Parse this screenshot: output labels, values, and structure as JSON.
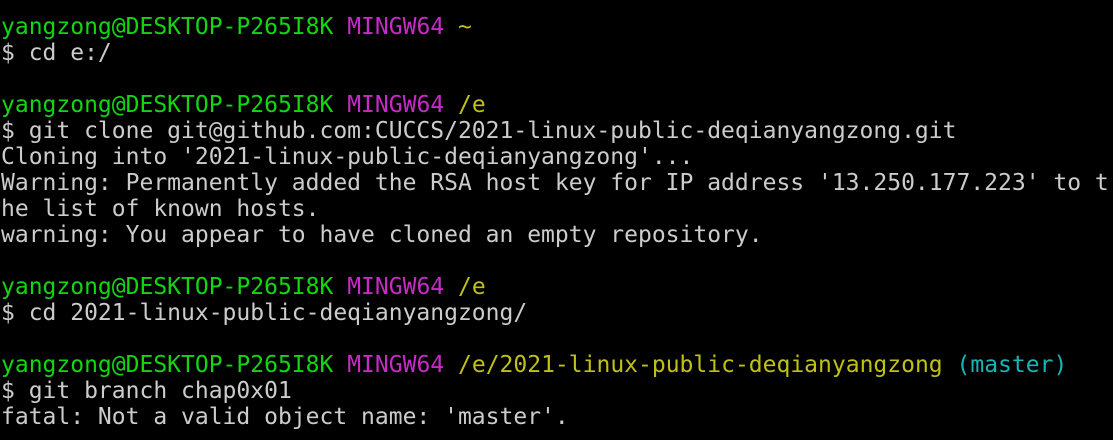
{
  "colors": {
    "background": "#000000",
    "default_text": "#cccccc",
    "user_host": "#13d613",
    "system": "#c62bc6",
    "path": "#c0c01a",
    "branch": "#19b5b5"
  },
  "terminal": {
    "blocks": [
      {
        "prompt": {
          "user_host": "yangzong@DESKTOP-P265I8K",
          "system": "MINGW64",
          "path": "~",
          "branch": ""
        },
        "command": "$ cd e:/",
        "output": []
      },
      {
        "prompt": {
          "user_host": "yangzong@DESKTOP-P265I8K",
          "system": "MINGW64",
          "path": "/e",
          "branch": ""
        },
        "command": "$ git clone git@github.com:CUCCS/2021-linux-public-deqianyangzong.git",
        "output": [
          "Cloning into '2021-linux-public-deqianyangzong'...",
          "Warning: Permanently added the RSA host key for IP address '13.250.177.223' to t",
          "he list of known hosts.",
          "warning: You appear to have cloned an empty repository."
        ]
      },
      {
        "prompt": {
          "user_host": "yangzong@DESKTOP-P265I8K",
          "system": "MINGW64",
          "path": "/e",
          "branch": ""
        },
        "command": "$ cd 2021-linux-public-deqianyangzong/",
        "output": []
      },
      {
        "prompt": {
          "user_host": "yangzong@DESKTOP-P265I8K",
          "system": "MINGW64",
          "path": "/e/2021-linux-public-deqianyangzong",
          "branch": "(master)"
        },
        "command": "$ git branch chap0x01",
        "output": [
          "fatal: Not a valid object name: 'master'."
        ]
      }
    ]
  }
}
